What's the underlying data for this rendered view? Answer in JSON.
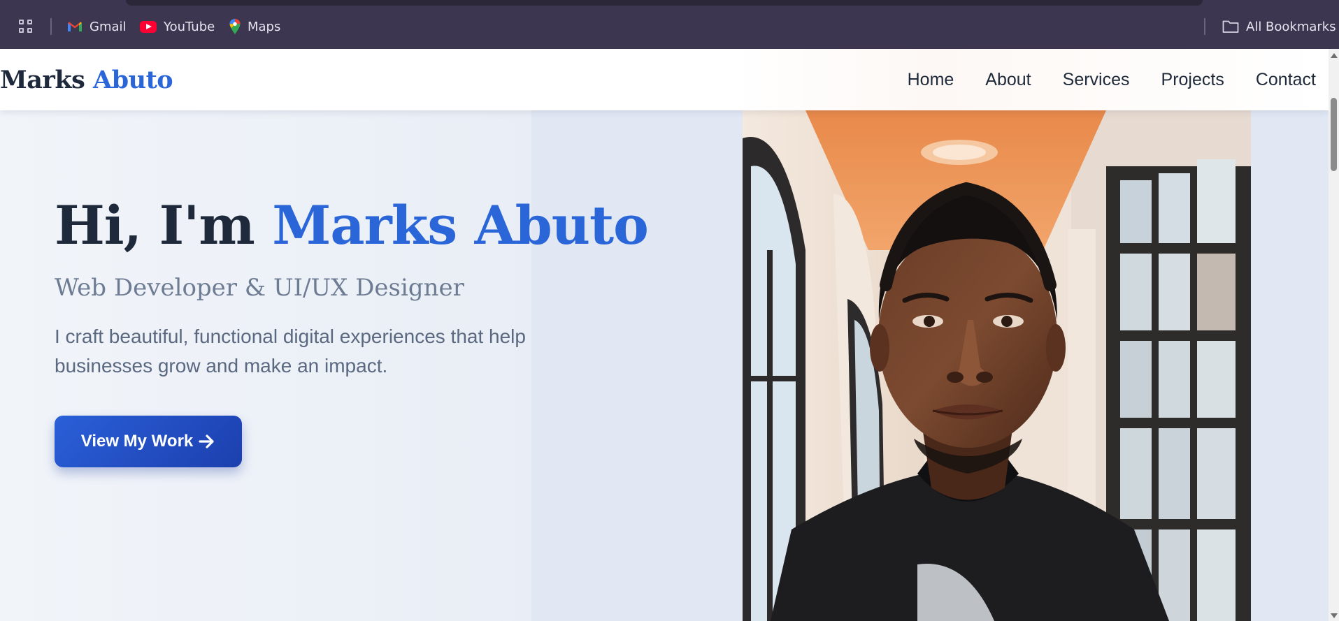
{
  "bookmarks_bar": {
    "items": [
      {
        "label": "Gmail",
        "icon": "gmail-icon"
      },
      {
        "label": "YouTube",
        "icon": "youtube-icon"
      },
      {
        "label": "Maps",
        "icon": "maps-icon"
      }
    ],
    "all_bookmarks": "All Bookmarks"
  },
  "navbar": {
    "logo_first": "Marks",
    "logo_accent": "Abuto",
    "links": [
      "Home",
      "About",
      "Services",
      "Projects",
      "Contact"
    ]
  },
  "hero": {
    "greeting": "Hi, I'm ",
    "name": "Marks Abuto",
    "subtitle": "Web Developer & UI/UX Designer",
    "description": "I craft beautiful, functional digital experiences that help businesses grow and make an impact.",
    "cta_label": "View My Work",
    "cta_icon": "arrow-right-icon"
  },
  "colors": {
    "accent": "#2b66d9",
    "heading": "#1e2a3b",
    "button": "#1f4fc8",
    "bookmarks_bar_bg": "#3c3650"
  }
}
